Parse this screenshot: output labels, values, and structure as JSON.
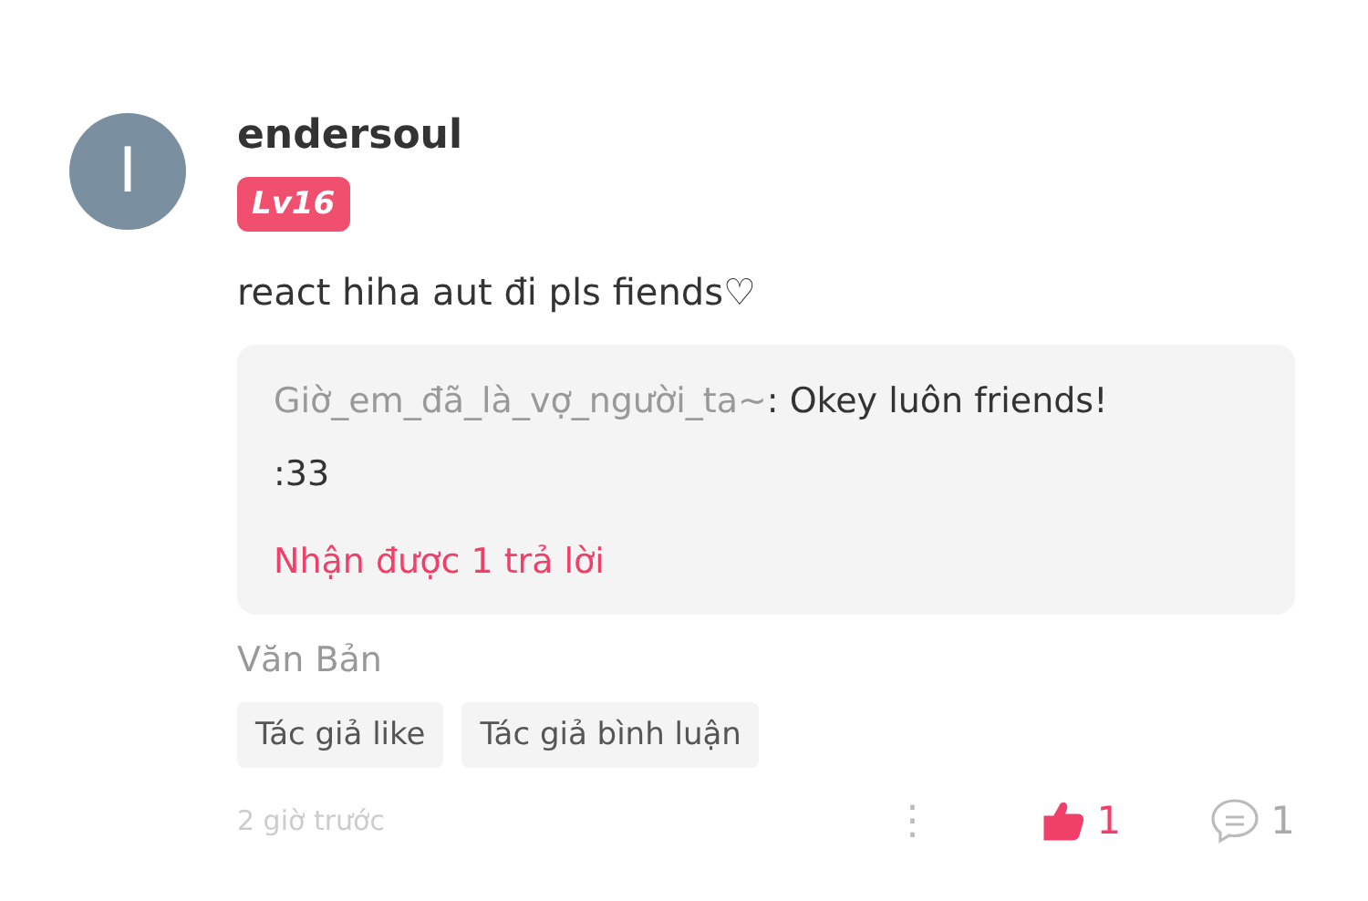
{
  "comment": {
    "avatar_letter": "I",
    "username": "endersoul",
    "level_badge": "Lv16",
    "text": "react hiha aut đi pls fiends♡",
    "reply": {
      "author": "Giờ_em_đã_là_vợ_người_ta~",
      "text": ": Okey luôn friends!",
      "text_line2": ":33",
      "reply_count": "Nhận được 1 trả lời"
    },
    "category": "Văn Bản",
    "tags": [
      "Tác giả like",
      "Tác giả bình luận"
    ],
    "time": "2 giờ trước",
    "more": "⋮",
    "likes": {
      "count": "1",
      "liked": true
    },
    "replies": {
      "count": "1"
    }
  }
}
